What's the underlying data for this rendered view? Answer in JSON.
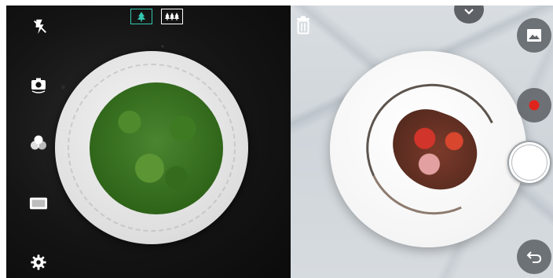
{
  "left_preview": {
    "toolbar": [
      {
        "name": "flash-off-icon"
      },
      {
        "name": "switch-camera-icon"
      },
      {
        "name": "filter-icon"
      },
      {
        "name": "aspect-ratio-icon"
      },
      {
        "name": "settings-icon"
      }
    ],
    "modes": [
      {
        "name": "mode-single-tree-icon",
        "active": true
      },
      {
        "name": "mode-multi-tree-icon",
        "active": false
      }
    ]
  },
  "right_preview": {
    "controls": [
      {
        "name": "trash-icon"
      },
      {
        "name": "chevron-down-icon"
      },
      {
        "name": "gallery-icon"
      },
      {
        "name": "record-icon"
      },
      {
        "name": "shutter-button"
      },
      {
        "name": "back-icon"
      }
    ]
  },
  "colors": {
    "accent": "#34c6b0",
    "record": "#e0241b",
    "control_bg": "#62666a"
  }
}
